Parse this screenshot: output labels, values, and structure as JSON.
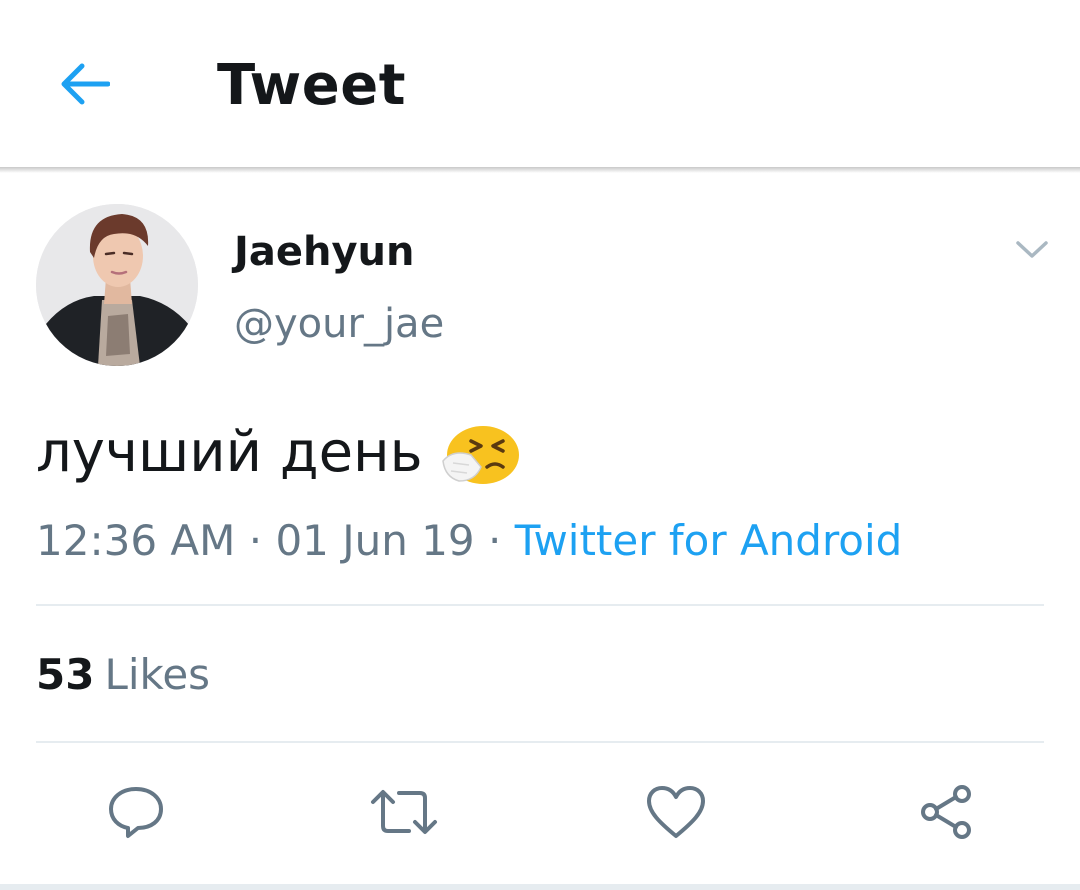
{
  "header": {
    "title": "Tweet",
    "back_icon": "arrow-left-icon"
  },
  "tweet": {
    "author": {
      "display_name": "Jaehyun",
      "handle": "@your_jae",
      "avatar": "profile-photo"
    },
    "text": "лучший день",
    "emoji": "sneezing-face-emoji",
    "time": "12:36 AM",
    "date": "01 Jun 19",
    "separator": "·",
    "source": "Twitter for Android",
    "likes": {
      "count": "53",
      "label": "Likes"
    }
  },
  "actions": [
    {
      "name": "reply",
      "icon": "reply-icon"
    },
    {
      "name": "retweet",
      "icon": "retweet-icon"
    },
    {
      "name": "like",
      "icon": "heart-icon"
    },
    {
      "name": "share",
      "icon": "share-icon"
    }
  ],
  "colors": {
    "accent": "#1da1f2",
    "text_primary": "#14171a",
    "text_secondary": "#657786",
    "divider": "#e6ecf0"
  }
}
